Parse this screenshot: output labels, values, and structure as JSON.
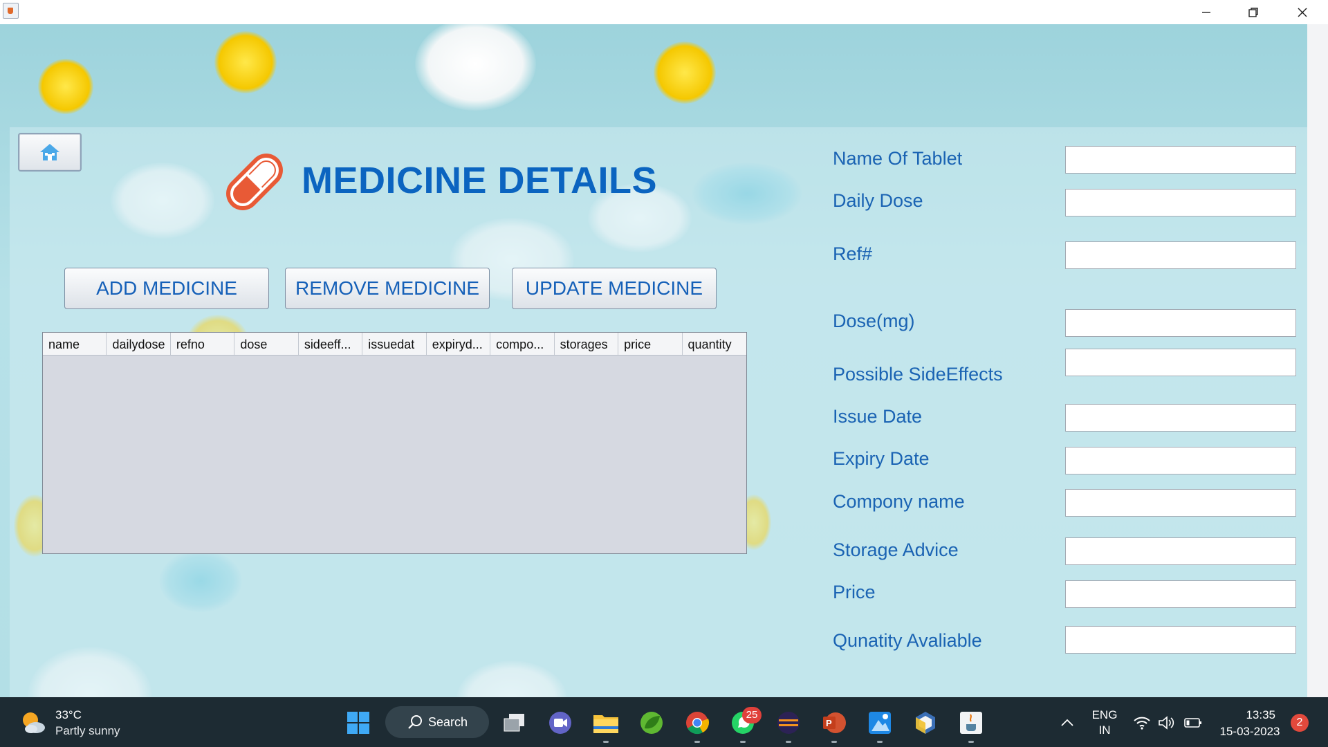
{
  "window": {
    "minimize_icon": "minimize-icon",
    "maximize_icon": "restore-icon",
    "close_icon": "close-icon"
  },
  "header": {
    "title": "MEDICINE DETAILS",
    "home_icon": "home-icon",
    "logo_icon": "capsule-icon"
  },
  "actions": {
    "add_label": "ADD MEDICINE",
    "remove_label": "REMOVE MEDICINE",
    "update_label": "UPDATE MEDICINE"
  },
  "table": {
    "columns": [
      "name",
      "dailydose",
      "refno",
      "dose",
      "sideeff...",
      "issuedat",
      "expiryd...",
      "compo...",
      "storages",
      "price",
      "quantity"
    ],
    "rows": []
  },
  "form": {
    "fields": [
      {
        "label": "Name Of Tablet",
        "value": ""
      },
      {
        "label": "Daily Dose",
        "value": ""
      },
      {
        "label": "Ref#",
        "value": ""
      },
      {
        "label": "Dose(mg)",
        "value": ""
      },
      {
        "label": "Possible SideEffects",
        "value": ""
      },
      {
        "label": "Issue Date",
        "value": ""
      },
      {
        "label": "Expiry Date",
        "value": ""
      },
      {
        "label": "Compony name",
        "value": ""
      },
      {
        "label": "Storage Advice",
        "value": ""
      },
      {
        "label": "Price",
        "value": ""
      },
      {
        "label": "Qunatity Avaliable",
        "value": ""
      }
    ]
  },
  "taskbar": {
    "weather_temp": "33°C",
    "weather_condition": "Partly sunny",
    "search_label": "Search",
    "whatsapp_badge": "25",
    "language_line1": "ENG",
    "language_line2": "IN",
    "time": "13:35",
    "date": "15-03-2023",
    "notification_count": "2",
    "icons": [
      "windows-start-icon",
      "search-icon",
      "task-view-icon",
      "meet-icon",
      "file-explorer-icon",
      "spring-tool-icon",
      "chrome-icon",
      "whatsapp-icon",
      "eclipse-icon",
      "powerpoint-icon",
      "paint-icon",
      "virtualbox-icon",
      "java-icon",
      "chevron-up-icon",
      "wifi-icon",
      "volume-icon",
      "battery-icon"
    ]
  },
  "colors": {
    "accent": "#0b64c0",
    "label": "#1a63b3",
    "capsule": "#e85a36",
    "taskbar": "#1d2b33"
  }
}
